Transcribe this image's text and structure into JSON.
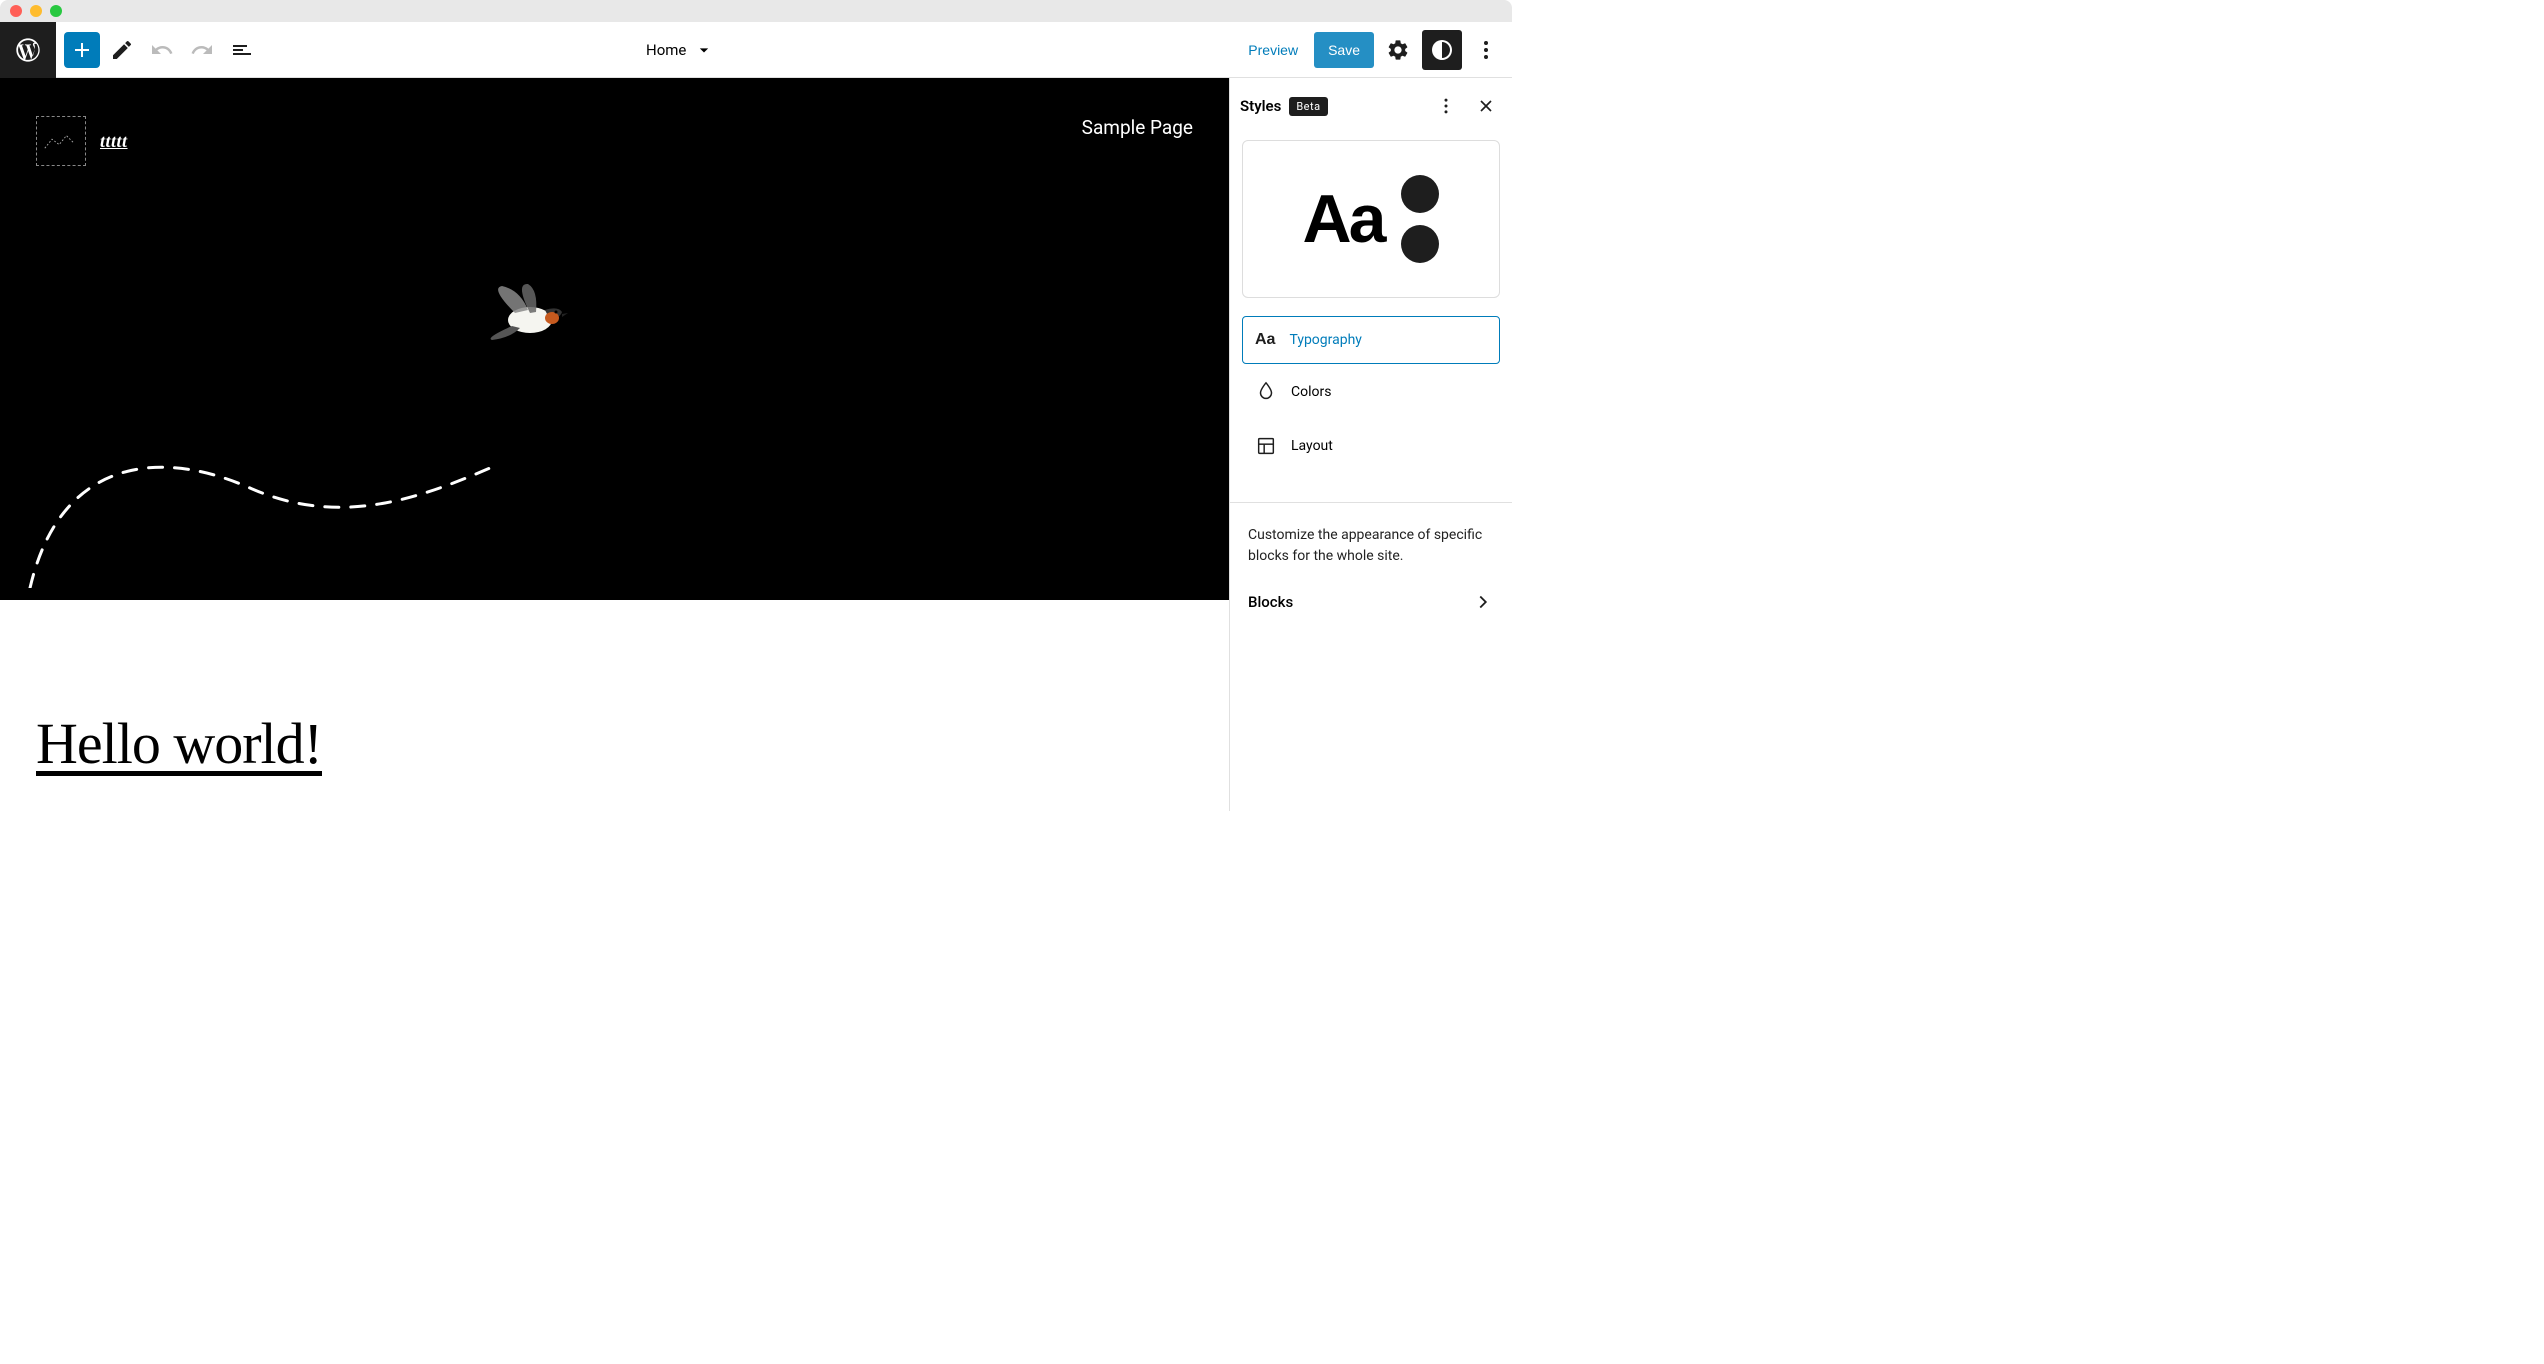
{
  "toolbar": {
    "page_name": "Home",
    "preview_label": "Preview",
    "save_label": "Save"
  },
  "hero": {
    "site_title": "ttttt",
    "nav_item": "Sample Page"
  },
  "post": {
    "title": "Hello world!"
  },
  "sidebar": {
    "title": "Styles",
    "badge": "Beta",
    "preview_text": "Aa",
    "items": [
      {
        "label": "Typography",
        "icon": "aa",
        "active": true
      },
      {
        "label": "Colors",
        "icon": "drop",
        "active": false
      },
      {
        "label": "Layout",
        "icon": "layout",
        "active": false
      }
    ],
    "blocks_desc": "Customize the appearance of specific blocks for the whole site.",
    "blocks_label": "Blocks"
  }
}
